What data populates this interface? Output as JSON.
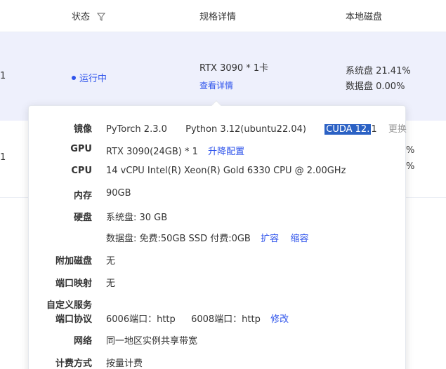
{
  "header": {
    "status_label": "状态",
    "spec_label": "规格详情",
    "disk_label": "本地磁盘"
  },
  "row1": {
    "id_fragment": "1",
    "status": "运行中",
    "spec": "RTX 3090 * 1卡",
    "spec_link": "查看详情",
    "disk_system": "系统盘 21.41%",
    "disk_data": "数据盘 0.00%"
  },
  "row2": {
    "id_fragment": "1",
    "disk_system_frag": "%",
    "disk_data_frag": "%"
  },
  "popover": {
    "image": {
      "label": "镜像",
      "pytorch": "PyTorch  2.3.0",
      "python": "Python  3.12(ubuntu22.04)",
      "cuda_selected": "CUDA  12.",
      "cuda_rest": "1",
      "change": "更换"
    },
    "gpu": {
      "label": "GPU",
      "value": "RTX 3090(24GB) * 1",
      "action": "升降配置"
    },
    "cpu": {
      "label": "CPU",
      "value": "14 vCPU Intel(R) Xeon(R) Gold 6330 CPU @ 2.00GHz"
    },
    "memory": {
      "label": "内存",
      "value": "90GB"
    },
    "disk": {
      "label": "硬盘",
      "system": "系统盘:  30 GB",
      "data": "数据盘:  免费:50GB SSD  付费:0GB",
      "expand": "扩容",
      "shrink": "缩容"
    },
    "extra_disk": {
      "label": "附加磁盘",
      "value": "无"
    },
    "port_mapping": {
      "label": "端口映射",
      "value": "无"
    },
    "custom_service": {
      "label_line1": "自定义服务",
      "label_line2": "端口协议",
      "port1": "6006端口：http",
      "port2": "6008端口：http",
      "modify": "修改"
    },
    "network": {
      "label": "网络",
      "value": "同一地区实例共享带宽"
    },
    "billing": {
      "label": "计费方式",
      "value": "按量计费"
    }
  }
}
